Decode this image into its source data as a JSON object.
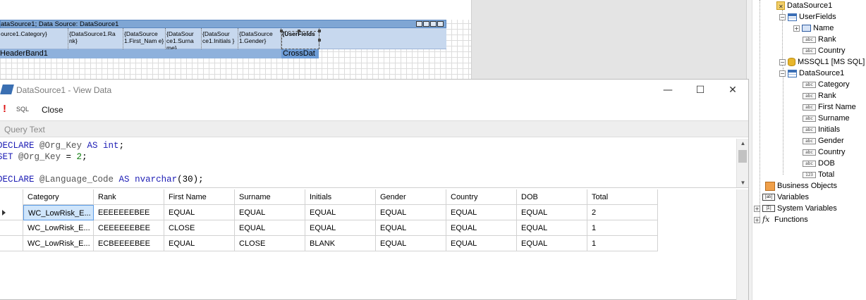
{
  "designer": {
    "header_band_title": "ataSource1; Data Source: DataSource1",
    "cells": [
      {
        "text": "ource1.Category}"
      },
      {
        "text": "{DataSource1.Ra nk}"
      },
      {
        "text": "{DataSource 1.First_Nam e}"
      },
      {
        "text": "{DataSour ce1.Surna me}"
      },
      {
        "text": "{DataSour ce1.Initials }"
      },
      {
        "text": "{DataSource 1.Gender}"
      },
      {
        "text": "{UserFields"
      }
    ],
    "footer_band_title": "HeaderBand1",
    "crossdat_label": "CrossDat"
  },
  "dialog": {
    "title": "DataSource1 - View Data",
    "toolbar": {
      "sql_label": "SQL",
      "close_label": "Close"
    },
    "query_header": "Query Text",
    "window_buttons": {
      "minimize": "—",
      "maximize": "☐",
      "close": "✕"
    }
  },
  "query_lines": [
    [
      {
        "t": "DECLARE ",
        "c": "kw"
      },
      {
        "t": "@Org_Key ",
        "c": "var"
      },
      {
        "t": "AS ",
        "c": "kw"
      },
      {
        "t": "int",
        "c": "kw"
      },
      {
        "t": ";",
        "c": ""
      }
    ],
    [
      {
        "t": "SET ",
        "c": "kw"
      },
      {
        "t": "@Org_Key ",
        "c": "var"
      },
      {
        "t": "= ",
        "c": ""
      },
      {
        "t": "2",
        "c": "num"
      },
      {
        "t": ";",
        "c": ""
      }
    ],
    [
      {
        "t": "",
        "c": ""
      }
    ],
    [
      {
        "t": "DECLARE ",
        "c": "kw"
      },
      {
        "t": "@Language_Code ",
        "c": "var"
      },
      {
        "t": "AS ",
        "c": "kw"
      },
      {
        "t": "nvarchar",
        "c": "kw"
      },
      {
        "t": "(30);",
        "c": ""
      }
    ]
  ],
  "grid": {
    "columns": [
      "Category",
      "Rank",
      "First Name",
      "Surname",
      "Initials",
      "Gender",
      "Country",
      "DOB",
      "Total"
    ],
    "rows": [
      [
        "WC_LowRisk_E...",
        "EEEEEEEBEE",
        "EQUAL",
        "EQUAL",
        "EQUAL",
        "EQUAL",
        "EQUAL",
        "EQUAL",
        "2"
      ],
      [
        "WC_LowRisk_E...",
        "CEEEEEEBEE",
        "CLOSE",
        "EQUAL",
        "EQUAL",
        "EQUAL",
        "EQUAL",
        "EQUAL",
        "1"
      ],
      [
        "WC_LowRisk_E...",
        "ECBEEEEBEE",
        "EQUAL",
        "CLOSE",
        "BLANK",
        "EQUAL",
        "EQUAL",
        "EQUAL",
        "1"
      ]
    ]
  },
  "tree": {
    "datasource1_top": "DataSource1",
    "userfields": "UserFields",
    "uf_name": "Name",
    "uf_rank": "Rank",
    "uf_country": "Country",
    "mssql": "MSSQL1 [MS SQL]",
    "ds_child": "DataSource1",
    "fields": [
      "Category",
      "Rank",
      "First Name",
      "Surname",
      "Initials",
      "Gender",
      "Country",
      "DOB",
      "Total"
    ],
    "business_objects": "Business Objects",
    "variables": "Variables",
    "system_variables": "System Variables",
    "functions": "Functions",
    "icon_abc": "abc",
    "icon_123": "123",
    "icon_var": "[ab]",
    "icon_sysvar": "[Σ]",
    "icon_fx": "fx",
    "expander_open": "−",
    "expander_closed": "+"
  }
}
